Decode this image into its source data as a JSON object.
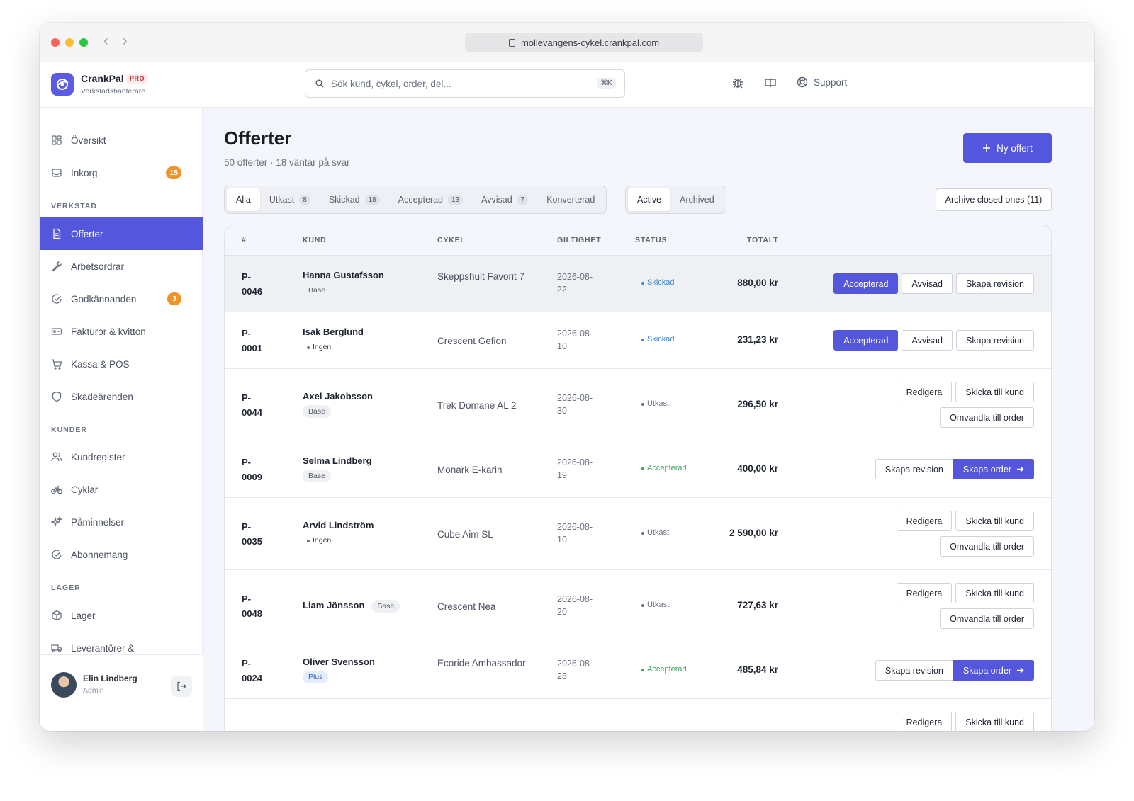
{
  "browser": {
    "url": "mollevangens-cykel.crankpal.com"
  },
  "brand": {
    "name": "CrankPal",
    "badge": "PRO",
    "subtitle": "Verkstadshanterare"
  },
  "search": {
    "placeholder": "Sök kund, cykel, order, del...",
    "shortcut": "⌘K"
  },
  "topnav": {
    "support_label": "Support"
  },
  "sidebar": {
    "items_top": [
      {
        "label": "Översikt",
        "icon": "grid-icon"
      },
      {
        "label": "Inkorg",
        "icon": "inbox-icon",
        "badge": "15"
      }
    ],
    "section_verkstad": "VERKSTAD",
    "items_verkstad": [
      {
        "label": "Offerter",
        "icon": "document-icon",
        "active": true
      },
      {
        "label": "Arbetsordrar",
        "icon": "wrench-icon"
      },
      {
        "label": "Godkännanden",
        "icon": "check-circle-icon",
        "badge": "3"
      },
      {
        "label": "Fakturor & kvitton",
        "icon": "receipt-icon"
      },
      {
        "label": "Kassa & POS",
        "icon": "cart-icon"
      },
      {
        "label": "Skadeärenden",
        "icon": "shield-icon"
      }
    ],
    "section_kunder": "KUNDER",
    "items_kunder": [
      {
        "label": "Kundregister",
        "icon": "users-icon"
      },
      {
        "label": "Cyklar",
        "icon": "bicycle-icon"
      },
      {
        "label": "Påminnelser",
        "icon": "sparkle-icon"
      },
      {
        "label": "Abonnemang",
        "icon": "check-circle-icon"
      }
    ],
    "section_lager": "LAGER",
    "items_lager": [
      {
        "label": "Lager",
        "icon": "box-icon"
      },
      {
        "label": "Leverantörer &",
        "icon": "truck-icon"
      }
    ],
    "user": {
      "name": "Elin Lindberg",
      "role": "Admin"
    }
  },
  "page": {
    "title": "Offerter",
    "subtitle": "50 offerter · 18 väntar på svar",
    "new_button": "Ny offert",
    "archive_button": "Archive closed ones (11)"
  },
  "status_tabs": [
    {
      "label": "Alla",
      "count": "",
      "selected": true
    },
    {
      "label": "Utkast",
      "count": "8"
    },
    {
      "label": "Skickad",
      "count": "18"
    },
    {
      "label": "Accepterad",
      "count": "13"
    },
    {
      "label": "Avvisad",
      "count": "7"
    },
    {
      "label": "Konverterad",
      "count": ""
    }
  ],
  "view_tabs": [
    {
      "label": "Active",
      "selected": true
    },
    {
      "label": "Archived"
    }
  ],
  "table": {
    "headers": {
      "id": "#",
      "customer": "KUND",
      "bike": "CYKEL",
      "validity": "GILTIGHET",
      "status": "STATUS",
      "total": "TOTALT"
    },
    "rows": [
      {
        "id": "P-0046",
        "customer": "Hanna Gustafsson",
        "plan": "Base",
        "bike": "Skeppshult Favorit 7",
        "validity": "2026-08-22",
        "status": "Skickad",
        "total": "880,00 kr",
        "actions": "sent"
      },
      {
        "id": "P-0001",
        "customer": "Isak Berglund",
        "plan": "Ingen",
        "bike": "Crescent Gefion",
        "validity": "2026-08-10",
        "status": "Skickad",
        "total": "231,23 kr",
        "actions": "sent"
      },
      {
        "id": "P-0044",
        "customer": "Axel Jakobsson",
        "plan": "Base",
        "bike": "Trek Domane AL 2",
        "validity": "2026-08-30",
        "status": "Utkast",
        "total": "296,50 kr",
        "actions": "draft"
      },
      {
        "id": "P-0009",
        "customer": "Selma Lindberg",
        "plan": "Base",
        "bike": "Monark E-karin",
        "validity": "2026-08-19",
        "status": "Accepterad",
        "total": "400,00 kr",
        "actions": "accepted"
      },
      {
        "id": "P-0035",
        "customer": "Arvid Lindström",
        "plan": "Ingen",
        "bike": "Cube Aim SL",
        "validity": "2026-08-10",
        "status": "Utkast",
        "total": "2 590,00 kr",
        "actions": "draft"
      },
      {
        "id": "P-0048",
        "customer": "Liam Jönsson",
        "plan": "Base",
        "bike": "Crescent Nea",
        "validity": "2026-08-20",
        "status": "Utkast",
        "total": "727,63 kr",
        "actions": "draft"
      },
      {
        "id": "P-0024",
        "customer": "Oliver Svensson",
        "plan": "Plus",
        "bike": "Ecoride Ambassador",
        "validity": "2026-08-28",
        "status": "Accepterad",
        "total": "485,84 kr",
        "actions": "accepted"
      }
    ],
    "action_labels": {
      "accept": "Accepterad",
      "reject": "Avvisad",
      "revision": "Skapa revision",
      "edit": "Redigera",
      "send": "Skicka till kund",
      "convert": "Omvandla till order",
      "create_order": "Skapa order"
    }
  },
  "colors": {
    "accent": "#5457db",
    "badge_orange": "#f0932b",
    "status_sent": "#3d87d6",
    "status_draft": "#6b7280",
    "status_accepted": "#3aa360"
  }
}
